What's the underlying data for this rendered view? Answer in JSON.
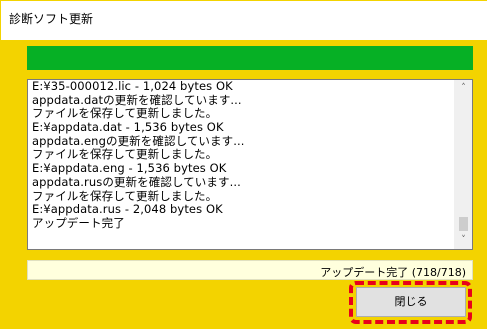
{
  "window": {
    "title": "診断ソフト更新",
    "bg_color": "#f3d300"
  },
  "progress": {
    "fraction": 1.0,
    "fill_color": "#06b025"
  },
  "log": {
    "lines": [
      "E:¥35-000012.lic - 1,024 bytes OK",
      "appdata.datの更新を確認しています...",
      "ファイルを保存して更新しました。",
      "E:¥appdata.dat - 1,536 bytes OK",
      "appdata.engの更新を確認しています...",
      "ファイルを保存して更新しました。",
      "E:¥appdata.eng - 1,536 bytes OK",
      "appdata.rusの更新を確認しています...",
      "ファイルを保存して更新しました。",
      "E:¥appdata.rus - 2,048 bytes OK",
      "アップデート完了"
    ],
    "scroll_up_icon": "chevron-up-icon",
    "scroll_down_icon": "chevron-down-icon"
  },
  "status": {
    "text": "アップデート完了 (718/718)"
  },
  "buttons": {
    "close_label": "閉じる",
    "highlight_color": "#e8001a"
  }
}
